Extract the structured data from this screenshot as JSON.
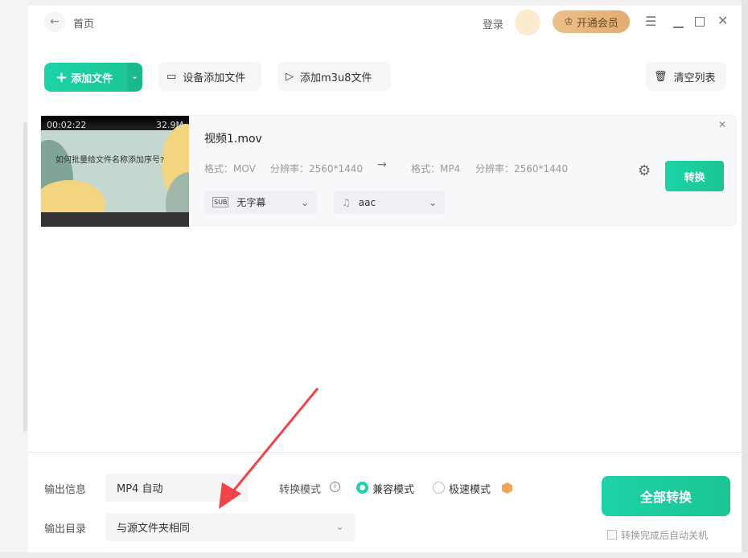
{
  "header": {
    "back_label": "首页",
    "login": "登录",
    "vip": "开通会员"
  },
  "toolbar": {
    "add_file": "添加文件",
    "device_add": "设备添加文件",
    "add_m3u8": "添加m3u8文件",
    "clear_list": "清空列表"
  },
  "files": [
    {
      "duration": "00:02:22",
      "size": "32.9M",
      "thumb_title": "如何批量给文件名称添加序号?",
      "name": "视频1.mov",
      "src_format": "格式：MOV",
      "src_res": "分辨率：2560*1440",
      "dst_format": "格式：MP4",
      "dst_res": "分辨率：2560*1440",
      "subtitle": "无字幕",
      "audio": "aac",
      "convert": "转换"
    }
  ],
  "footer": {
    "output_info_label": "输出信息",
    "output_info_value": "MP4 自动",
    "mode_label": "转换模式",
    "mode_compat": "兼容模式",
    "mode_fast": "极速模式",
    "output_dir_label": "输出目录",
    "output_dir_value": "与源文件夹相同",
    "convert_all": "全部转换",
    "shutdown": "转换完成后自动关机"
  },
  "colors": {
    "accent": "#1bcc9e",
    "vip": "#e6b47c",
    "arrow": "#f0434a"
  }
}
